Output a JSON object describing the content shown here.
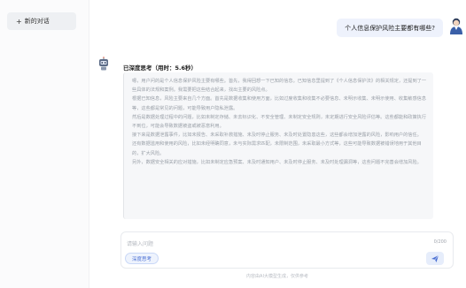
{
  "sidebar": {
    "new_chat_label": "新的对话",
    "new_chat_icon": "plus-icon"
  },
  "conversation": {
    "user_message": "个人信息保护风险主要都有哪些?",
    "assistant": {
      "think_title": "已深度思考（用时：5.6秒）",
      "paragraphs": [
        "嗯，用户问的是个人信息保护风险主要有哪些。首先，我得回想一下已知的信息。已知信息里提到了《个人信息保护法》的相关规定，还提到了一些具体的法规和案例。我需要把这些结合起来，找出主要的风险点。",
        "根据已知信息，风险主要来自几个方面。首先是数据收集和使用方面，比如过度收集和收集不必要信息、未明示收集、未明示使用、收集敏感信息等，这些都是常见的问题，可能导致用户隐私泄露。",
        "然后是数据处理过程中的问题，比如未制定存储、未去标识化、不安全管理、未制定安全规则，未定期进行安全风险评估等。这些都能和政策执行不到位，可能会导致数据被盗或被恶意利用。",
        "接下来是数据泄露事件，比如未报告、未采取补救措施、未及时停止服务、未及时处置隐患这些，这些都会增加泄露的风险，影响用户的信任。",
        "还有数据滥用和使用的风险，比如未经明确同意，未与实际需求匹配，未限制范围，未采取最小方式等，这些可能导致数据被错误地用于其他目的，扩大风险。",
        "另外，数据安全相关的应对措施，比如未制定应急预案、未及时通知用户、未及时停止服务、未及时处理漏洞等，这些问题不完善会增加风险。"
      ]
    }
  },
  "composer": {
    "placeholder": "请输入问题",
    "char_count": "0/200",
    "deep_think_label": "深度思考",
    "send_icon": "send-icon"
  },
  "footer": {
    "note": "内容由AI大模型生成，仅供参考"
  },
  "colors": {
    "accent": "#4a6fd3",
    "user_bubble": "#eef2fc",
    "answer_bg": "#f6f7f9"
  }
}
